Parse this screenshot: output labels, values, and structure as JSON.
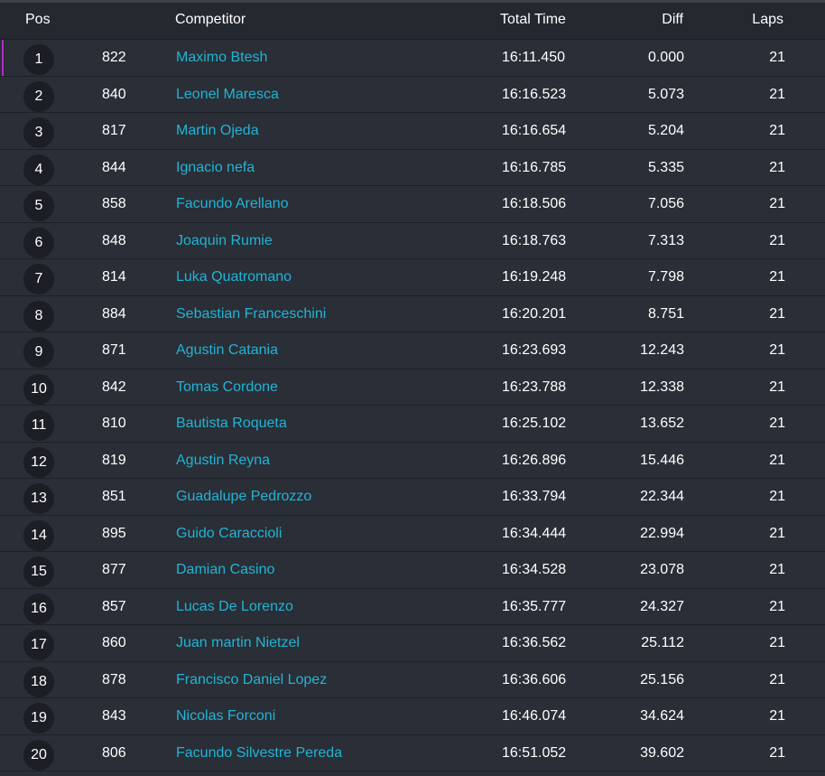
{
  "header": {
    "pos": "Pos",
    "competitor": "Competitor",
    "total_time": "Total Time",
    "diff": "Diff",
    "laps": "Laps"
  },
  "colors": {
    "background": "#2a2e36",
    "link": "#21b4d6",
    "leader_marker": "#b02ac8"
  },
  "rows": [
    {
      "pos": "1",
      "num": "822",
      "name": "Maximo Btesh",
      "time": "16:11.450",
      "diff": "0.000",
      "laps": "21"
    },
    {
      "pos": "2",
      "num": "840",
      "name": "Leonel Maresca",
      "time": "16:16.523",
      "diff": "5.073",
      "laps": "21"
    },
    {
      "pos": "3",
      "num": "817",
      "name": "Martin Ojeda",
      "time": "16:16.654",
      "diff": "5.204",
      "laps": "21"
    },
    {
      "pos": "4",
      "num": "844",
      "name": "Ignacio nefa",
      "time": "16:16.785",
      "diff": "5.335",
      "laps": "21"
    },
    {
      "pos": "5",
      "num": "858",
      "name": "Facundo Arellano",
      "time": "16:18.506",
      "diff": "7.056",
      "laps": "21"
    },
    {
      "pos": "6",
      "num": "848",
      "name": "Joaquin Rumie",
      "time": "16:18.763",
      "diff": "7.313",
      "laps": "21"
    },
    {
      "pos": "7",
      "num": "814",
      "name": "Luka Quatromano",
      "time": "16:19.248",
      "diff": "7.798",
      "laps": "21"
    },
    {
      "pos": "8",
      "num": "884",
      "name": "Sebastian Franceschini",
      "time": "16:20.201",
      "diff": "8.751",
      "laps": "21"
    },
    {
      "pos": "9",
      "num": "871",
      "name": "Agustin Catania",
      "time": "16:23.693",
      "diff": "12.243",
      "laps": "21"
    },
    {
      "pos": "10",
      "num": "842",
      "name": "Tomas Cordone",
      "time": "16:23.788",
      "diff": "12.338",
      "laps": "21"
    },
    {
      "pos": "11",
      "num": "810",
      "name": "Bautista Roqueta",
      "time": "16:25.102",
      "diff": "13.652",
      "laps": "21"
    },
    {
      "pos": "12",
      "num": "819",
      "name": "Agustin Reyna",
      "time": "16:26.896",
      "diff": "15.446",
      "laps": "21"
    },
    {
      "pos": "13",
      "num": "851",
      "name": "Guadalupe Pedrozzo",
      "time": "16:33.794",
      "diff": "22.344",
      "laps": "21"
    },
    {
      "pos": "14",
      "num": "895",
      "name": "Guido Caraccioli",
      "time": "16:34.444",
      "diff": "22.994",
      "laps": "21"
    },
    {
      "pos": "15",
      "num": "877",
      "name": "Damian Casino",
      "time": "16:34.528",
      "diff": "23.078",
      "laps": "21"
    },
    {
      "pos": "16",
      "num": "857",
      "name": "Lucas De Lorenzo",
      "time": "16:35.777",
      "diff": "24.327",
      "laps": "21"
    },
    {
      "pos": "17",
      "num": "860",
      "name": "Juan martin Nietzel",
      "time": "16:36.562",
      "diff": "25.112",
      "laps": "21"
    },
    {
      "pos": "18",
      "num": "878",
      "name": "Francisco Daniel Lopez",
      "time": "16:36.606",
      "diff": "25.156",
      "laps": "21"
    },
    {
      "pos": "19",
      "num": "843",
      "name": "Nicolas Forconi",
      "time": "16:46.074",
      "diff": "34.624",
      "laps": "21"
    },
    {
      "pos": "20",
      "num": "806",
      "name": "Facundo Silvestre Pereda",
      "time": "16:51.052",
      "diff": "39.602",
      "laps": "21"
    }
  ]
}
